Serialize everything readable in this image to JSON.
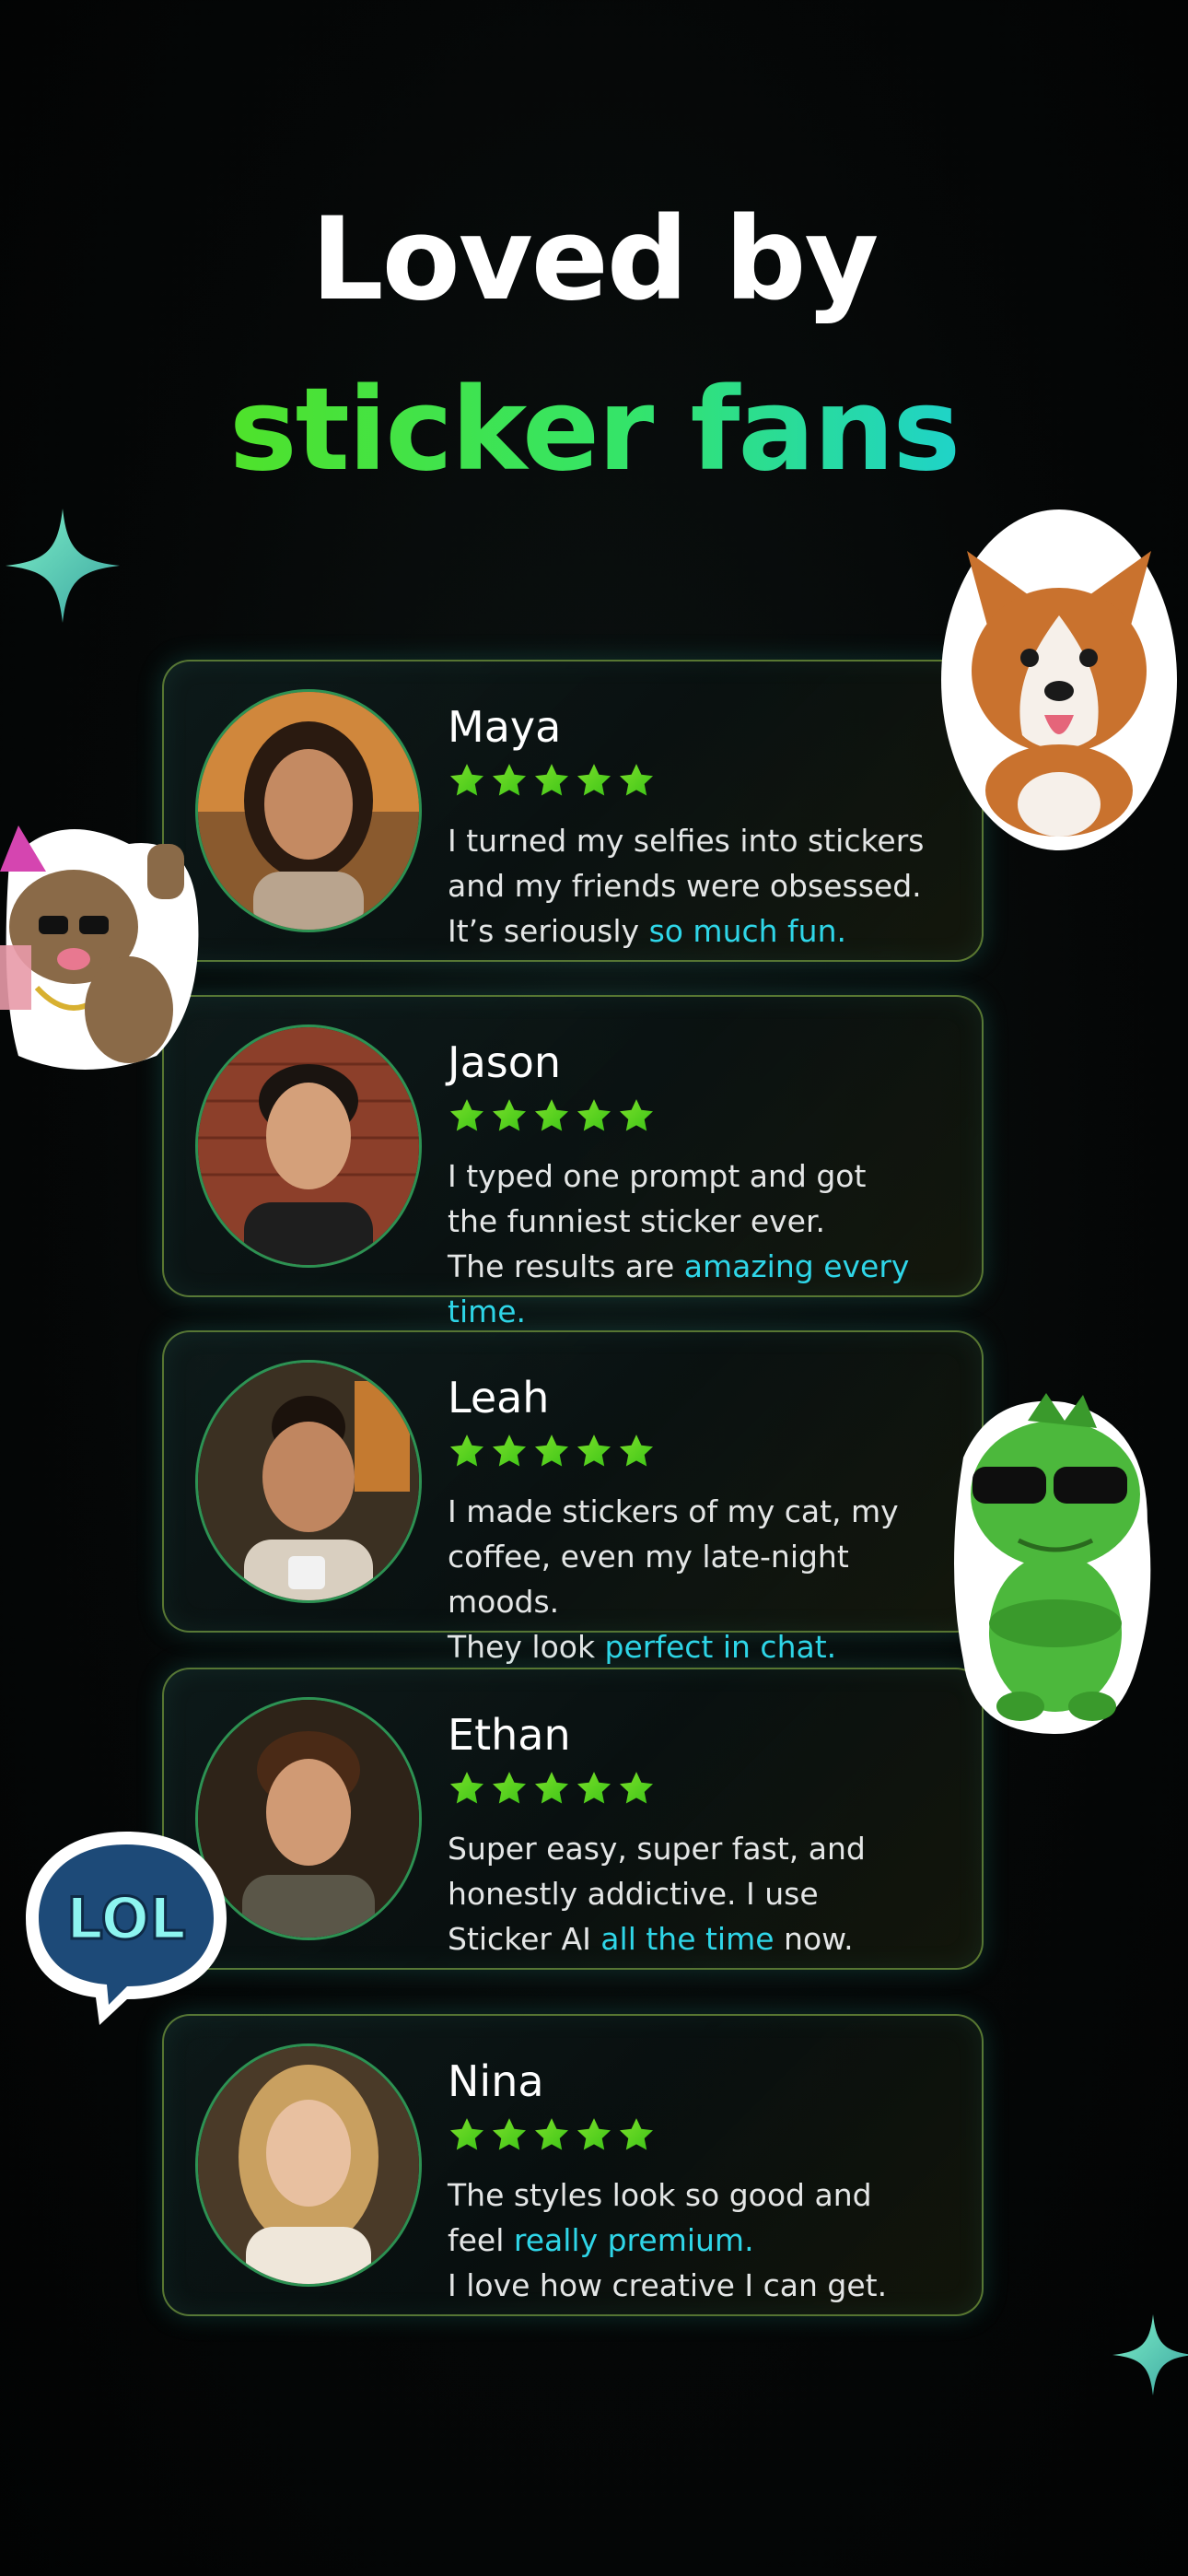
{
  "headline": {
    "line1": "Loved by",
    "line2": "sticker fans"
  },
  "colors": {
    "accent_green": "#4fe22a",
    "accent_cyan": "#1fd3c9",
    "star_green": "#5fd41c",
    "highlight": "#2fd6e8"
  },
  "stickers": {
    "corgi": "corgi-sticker",
    "cat": "party-cat-sticker",
    "dino": "sunglasses-dino-sticker",
    "lol_label": "LOL"
  },
  "reviews": [
    {
      "name": "Maya",
      "rating": 5,
      "line1": "I turned my selfies into stickers",
      "line2": "and my friends were obsessed.",
      "line3_pre": "It’s seriously ",
      "line3_hl": "so much fun.",
      "line3_post": ""
    },
    {
      "name": "Jason",
      "rating": 5,
      "line1": "I typed one prompt and got",
      "line2": "the funniest sticker ever.",
      "line3_pre": "The results are ",
      "line3_hl": "amazing every time.",
      "line3_post": ""
    },
    {
      "name": "Leah",
      "rating": 5,
      "line1": "I made stickers of my cat, my",
      "line2": "coffee, even my late-night moods.",
      "line3_pre": "They look ",
      "line3_hl": "perfect in chat.",
      "line3_post": ""
    },
    {
      "name": "Ethan",
      "rating": 5,
      "line1": "Super easy, super fast, and",
      "line2": "honestly addictive. I use",
      "line3_pre": "Sticker AI ",
      "line3_hl": "all the time",
      "line3_post": " now."
    },
    {
      "name": "Nina",
      "rating": 5,
      "line1": "The styles look so good and",
      "line2_pre": "feel ",
      "line2_hl": "really premium.",
      "line3": "I love how creative I can get."
    }
  ]
}
